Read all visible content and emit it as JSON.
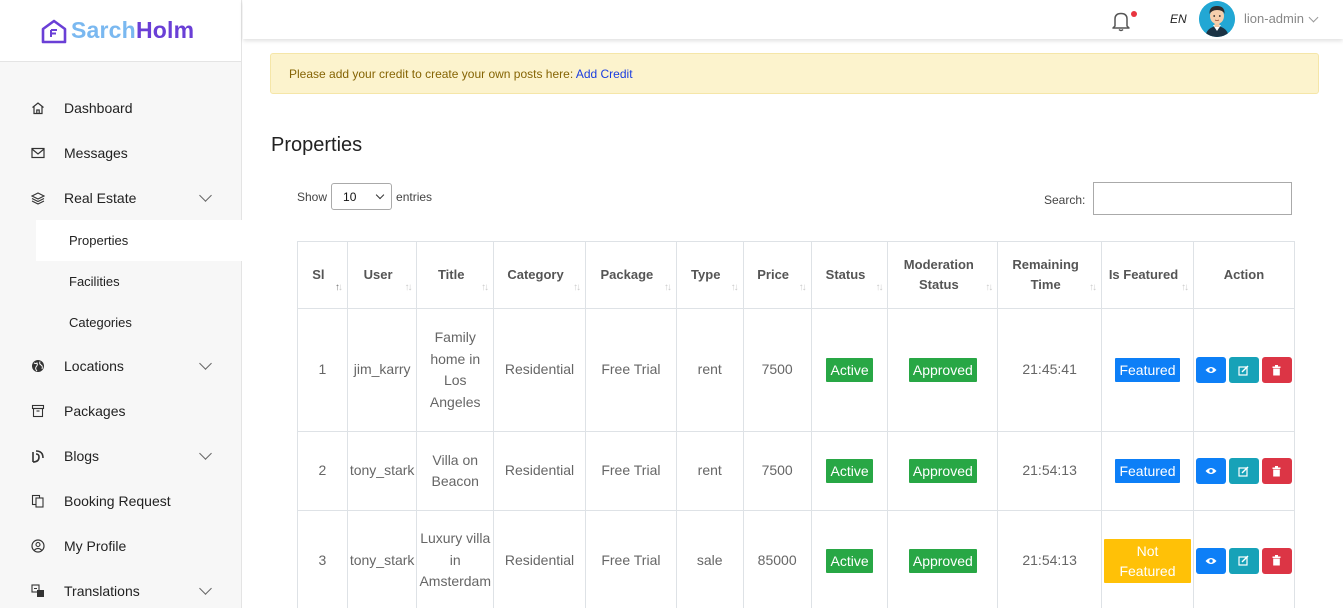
{
  "brand": {
    "part1": "Sarch",
    "part2": "Holm"
  },
  "nav": {
    "items": [
      {
        "label": "Dashboard",
        "icon": "home-icon"
      },
      {
        "label": "Messages",
        "icon": "mail-icon"
      },
      {
        "label": "Real Estate",
        "icon": "layers-icon",
        "expanded": true
      },
      {
        "label": "Locations",
        "icon": "globe-icon"
      },
      {
        "label": "Packages",
        "icon": "archive-icon"
      },
      {
        "label": "Blogs",
        "icon": "blog-icon"
      },
      {
        "label": "Booking Request",
        "icon": "copy-icon"
      },
      {
        "label": "My Profile",
        "icon": "user-circle-icon"
      },
      {
        "label": "Translations",
        "icon": "translate-icon"
      }
    ],
    "subitems": [
      "Properties",
      "Facilities",
      "Categories"
    ]
  },
  "topbar": {
    "lang": "EN",
    "username": "lion-admin"
  },
  "alert": {
    "text": "Please add your credit to create your own posts here: ",
    "link": "Add Credit"
  },
  "page": {
    "title": "Properties"
  },
  "controls": {
    "show": "Show",
    "entries_value": "10",
    "entries": "entries",
    "search": "Search:"
  },
  "table": {
    "headers": [
      "Sl",
      "User",
      "Title",
      "Category",
      "Package",
      "Type",
      "Price",
      "Status",
      "Moderation Status",
      "Remaining Time",
      "Is Featured",
      "Action"
    ],
    "rows": [
      {
        "sl": "1",
        "user": "jim_karry",
        "title": "Family home in Los Angeles",
        "category": "Residential",
        "package": "Free Trial",
        "type": "rent",
        "price": "7500",
        "status": "Active",
        "moderation": "Approved",
        "remaining": "21:45:41",
        "featured": "Featured"
      },
      {
        "sl": "2",
        "user": "tony_stark",
        "title": "Villa on Beacon",
        "category": "Residential",
        "package": "Free Trial",
        "type": "rent",
        "price": "7500",
        "status": "Active",
        "moderation": "Approved",
        "remaining": "21:54:13",
        "featured": "Featured"
      },
      {
        "sl": "3",
        "user": "tony_stark",
        "title": "Luxury villa in Amsterdam",
        "category": "Residential",
        "package": "Free Trial",
        "type": "sale",
        "price": "85000",
        "status": "Active",
        "moderation": "Approved",
        "remaining": "21:54:13",
        "featured": "Not Featured"
      }
    ]
  },
  "colors": {
    "accent": "#6a3fd6",
    "success": "#28a745",
    "primary": "#0d7ff7",
    "info": "#17a2b8",
    "danger": "#dc3545",
    "warning": "#ffc107"
  }
}
